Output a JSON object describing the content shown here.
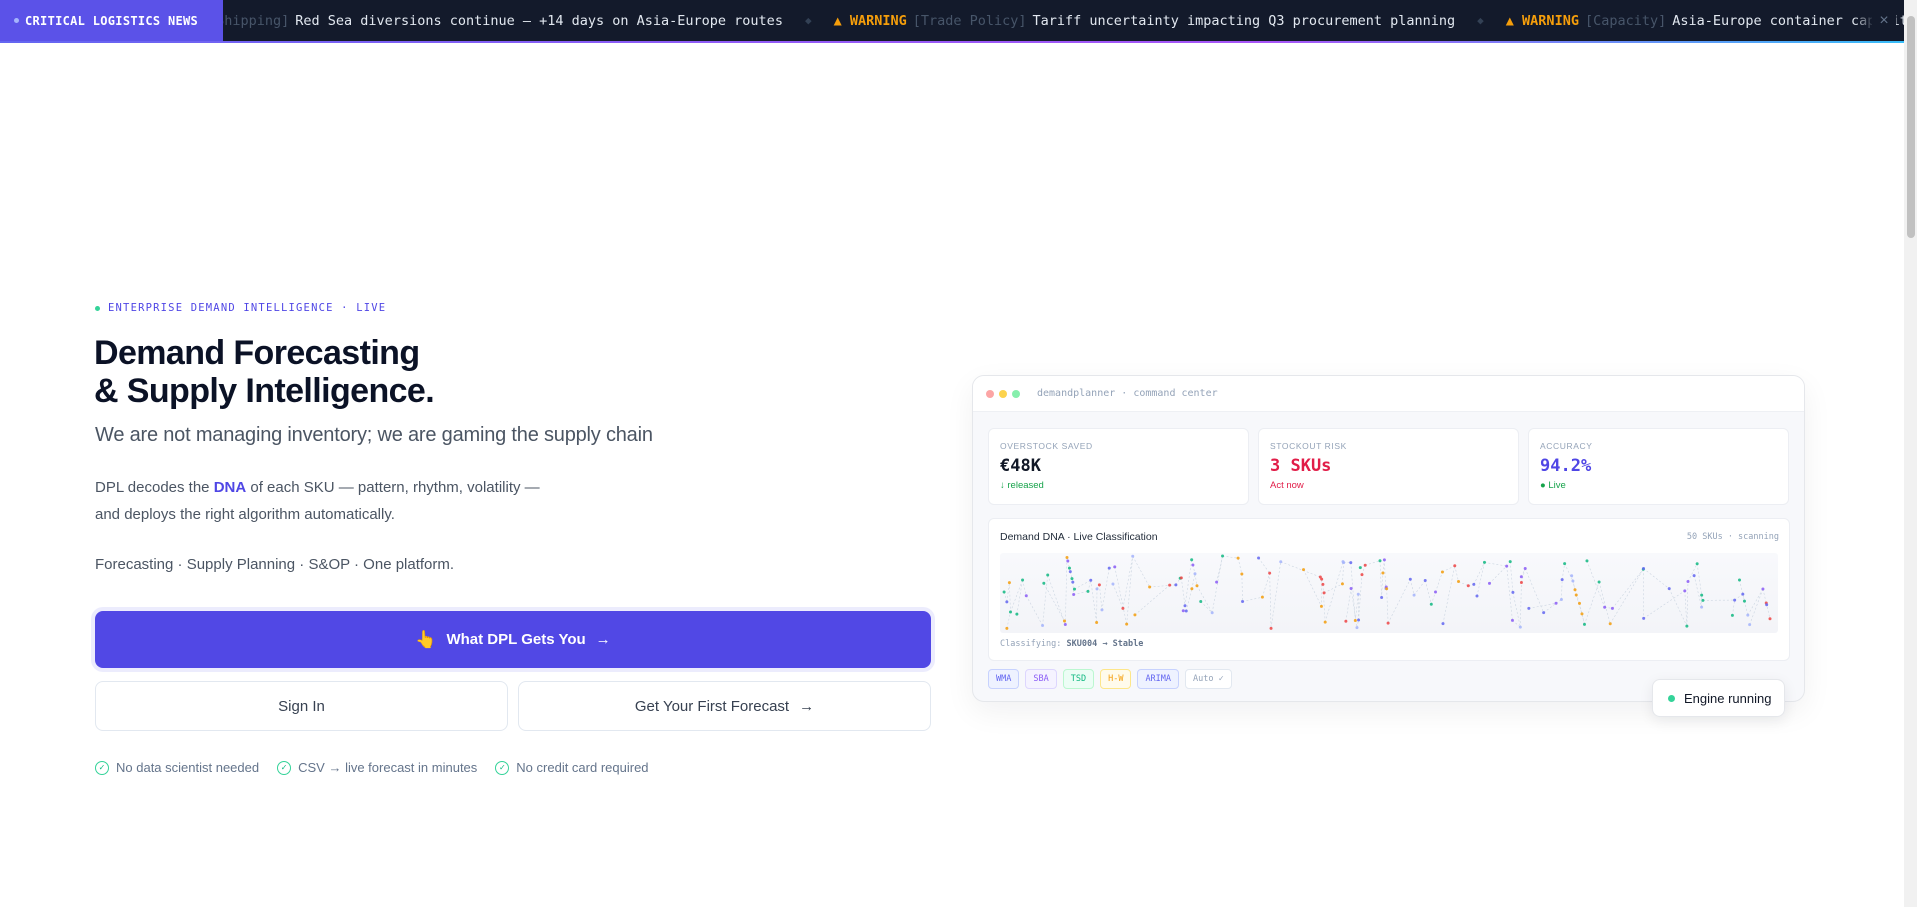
{
  "ticker": {
    "label": "CRITICAL LOGISTICS NEWS",
    "items": [
      {
        "severity": "",
        "tag": "[Shipping]",
        "text": "Red Sea diversions continue — +14 days on Asia-Europe routes"
      },
      {
        "severity": "▲ WARNING",
        "tag": "[Trade Policy]",
        "text": "Tariff uncertainty impacting Q3 procurement planning"
      },
      {
        "severity": "▲ WARNING",
        "tag": "[Capacity]",
        "text": "Asia-Europe container capacity t"
      }
    ],
    "close_icon": "×"
  },
  "hero": {
    "eyebrow": "ENTERPRISE DEMAND INTELLIGENCE · LIVE",
    "headline_line1": "Demand Forecasting",
    "headline_line2": "& Supply Intelligence.",
    "subhead": "We are not managing inventory; we are gaming the supply chain",
    "desc_pre": "DPL decodes the ",
    "desc_dna": "DNA",
    "desc_post": " of each SKU — pattern, rhythm, volatility —",
    "desc_line2": "and deploys the right algorithm automatically.",
    "platform": "Forecasting · Supply Planning · S&OP · One platform.",
    "cta_icon": "👆",
    "cta_primary": "What DPL Gets You",
    "cta_arrow": "→",
    "sign_in": "Sign In",
    "first_forecast": "Get Your First Forecast",
    "first_forecast_arrow": "→",
    "trust": [
      "No data scientist needed",
      "CSV → live forecast in minutes",
      "No credit card required"
    ],
    "check_glyph": "✓"
  },
  "dashboard": {
    "title": "demandplanner · command center",
    "kpis": [
      {
        "label": "OVERSTOCK SAVED",
        "value": "€48K",
        "sub": "↓ released",
        "value_color": "#111827",
        "sub_color": "#16a34a"
      },
      {
        "label": "STOCKOUT RISK",
        "value": "3 SKUs",
        "sub": "Act now",
        "value_color": "#e11d48",
        "sub_color": "#e11d48"
      },
      {
        "label": "ACCURACY",
        "value": "94.2%",
        "sub": "● Live",
        "value_color": "#4f46e5",
        "sub_color": "#16a34a"
      }
    ],
    "dna_title": "Demand DNA · Live Classification",
    "dna_meta": "50 SKUs · scanning",
    "classifying_label": "Classifying:",
    "classifying_value": "SKU004 → Stable",
    "chips": [
      {
        "label": "WMA",
        "color": "#6366f1"
      },
      {
        "label": "SBA",
        "color": "#8b5cf6"
      },
      {
        "label": "TSD",
        "color": "#10b981"
      },
      {
        "label": "H-W",
        "color": "#f59e0b"
      },
      {
        "label": "ARIMA",
        "color": "#6366f1"
      },
      {
        "label": "Auto ✓",
        "color": "#94a3b8"
      }
    ],
    "engine_label": "Engine running"
  }
}
